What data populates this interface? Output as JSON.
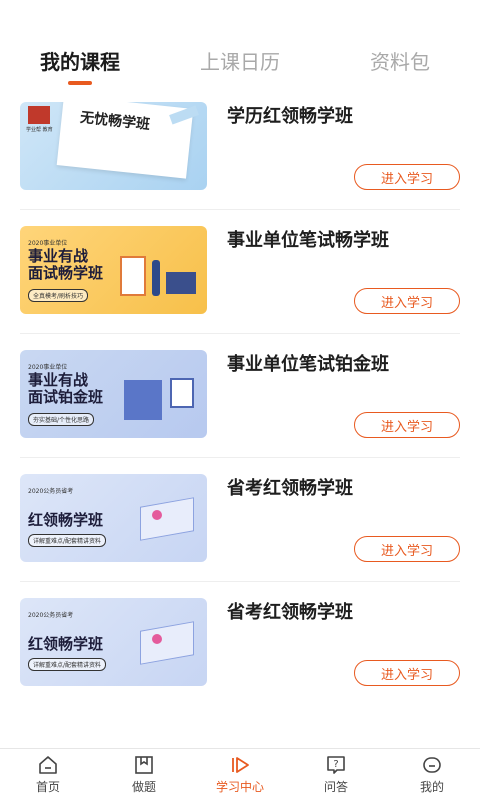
{
  "tabs": [
    {
      "label": "我的课程",
      "active": true
    },
    {
      "label": "上课日历",
      "active": false
    },
    {
      "label": "资料包",
      "active": false
    }
  ],
  "courses": [
    {
      "title": "学历红领畅学班",
      "button": "进入学习",
      "thumb": {
        "style": "blue",
        "logo_small": "学业帮 教育",
        "headline": "无忧畅学班"
      }
    },
    {
      "title": "事业单位笔试畅学班",
      "button": "进入学习",
      "thumb": {
        "style": "yellow",
        "tag_top": "2020事业单位",
        "headline_1": "事业有战",
        "headline_2": "面试畅学班",
        "tag_bottom": "全真模考/刷析技巧"
      }
    },
    {
      "title": "事业单位笔试铂金班",
      "button": "进入学习",
      "thumb": {
        "style": "lav",
        "tag_top": "2020事业单位",
        "headline_1": "事业有战",
        "headline_2": "面试铂金班",
        "tag_bottom": "夯实基础/个性化思路"
      }
    },
    {
      "title": "省考红领畅学班",
      "button": "进入学习",
      "thumb": {
        "style": "lav2",
        "tag_top": "2020公务员省考",
        "headline_1": "红领畅学班",
        "tag_bottom": "详解重难点/配套精讲资料"
      }
    },
    {
      "title": "省考红领畅学班",
      "button": "进入学习",
      "thumb": {
        "style": "lav2",
        "tag_top": "2020公务员省考",
        "headline_1": "红领畅学班",
        "tag_bottom": "详解重难点/配套精讲资料"
      }
    }
  ],
  "nav": [
    {
      "label": "首页",
      "icon": "home-icon"
    },
    {
      "label": "做题",
      "icon": "book-icon"
    },
    {
      "label": "学习中心",
      "icon": "play-icon",
      "active": true
    },
    {
      "label": "问答",
      "icon": "question-icon"
    },
    {
      "label": "我的",
      "icon": "profile-icon"
    }
  ],
  "colors": {
    "accent": "#e85a20"
  }
}
